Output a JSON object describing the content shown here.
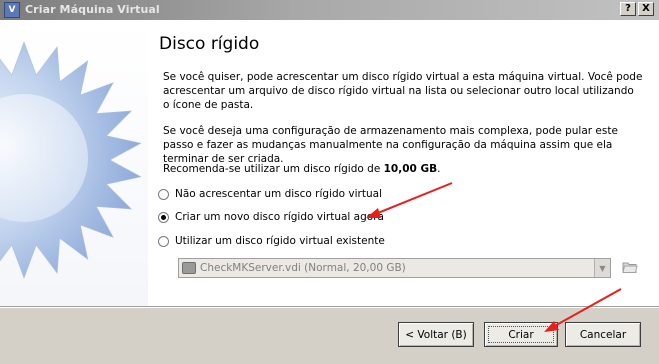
{
  "window": {
    "title": "Criar Máquina Virtual",
    "help_label": "?",
    "close_label": "X"
  },
  "page": {
    "heading": "Disco rígido",
    "paragraph1": "Se você quiser, pode acrescentar um disco rígido virtual a esta máquina virtual. Você pode acrescentar um arquivo de disco rígido virtual na lista ou selecionar outro local utilizando o ícone de pasta.",
    "paragraph2": "Se você deseja uma configuração de armazenamento mais complexa, pode pular este passo e fazer as mudanças manualmente na configuração da máquina assim que ela terminar de ser criada.",
    "recommend_prefix": "Recomenda-se utilizar um disco rígido de ",
    "recommend_size": "10,00 GB",
    "recommend_suffix": "."
  },
  "options": [
    {
      "label": "Não acrescentar um disco rígido virtual",
      "selected": false
    },
    {
      "label": "Criar um novo disco rígido virtual agora",
      "selected": true
    },
    {
      "label": "Utilizar um disco rígido virtual existente",
      "selected": false
    }
  ],
  "existing_disk": {
    "value": "CheckMKServer.vdi (Normal, 20,00 GB)",
    "enabled": false
  },
  "buttons": {
    "back": "< Voltar (B)",
    "create": "Criar",
    "cancel": "Cancelar"
  },
  "colors": {
    "accent_blue": "#4a7cc4",
    "annotation_red": "#e8201a"
  },
  "icons": {
    "app": "virtualbox-icon",
    "folder": "folder-open-icon",
    "disk": "hard-disk-icon"
  }
}
